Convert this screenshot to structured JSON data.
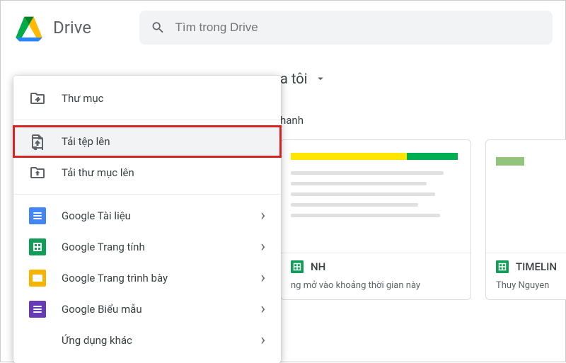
{
  "header": {
    "product_name": "Drive",
    "search_placeholder": "Tìm trong Drive"
  },
  "breadcrumb": {
    "current": "a tôi"
  },
  "section": {
    "quick_access_label": "hanh"
  },
  "cards": [
    {
      "title": "NH",
      "subtitle": "ng mở vào khoảng thời gian này"
    },
    {
      "title": "TIMELIN",
      "subtitle": "Thuy Nguyen"
    }
  ],
  "context_menu": {
    "new_folder": "Thư mục",
    "upload_file": "Tải tệp lên",
    "upload_folder": "Tải thư mục lên",
    "google_docs": "Google Tài liệu",
    "google_sheets": "Google Trang tính",
    "google_slides": "Google Trang trình bày",
    "google_forms": "Google Biểu mẫu",
    "more_apps": "Ứng dụng khác"
  }
}
